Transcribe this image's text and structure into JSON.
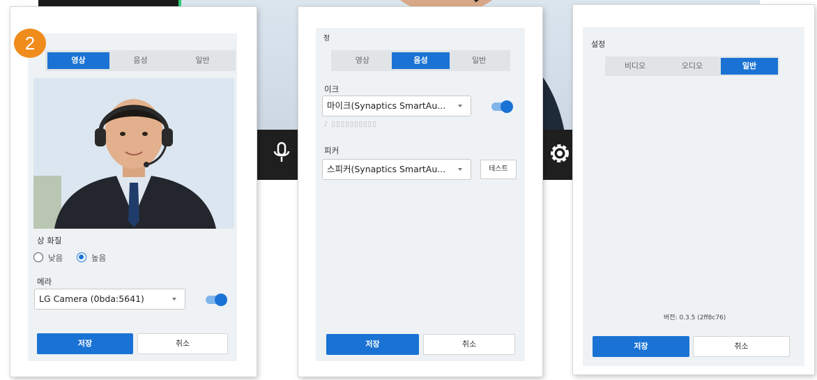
{
  "step_badge": "2",
  "panel1": {
    "tabs": [
      "영상",
      "음성",
      "일반"
    ],
    "active_tab": 0,
    "quality_label": "상 화질",
    "quality_options": [
      "낮음",
      "높음"
    ],
    "quality_selected": 1,
    "camera_label": "메라",
    "camera_value": "LG Camera (0bda:5641)",
    "camera_enabled": true,
    "save_label": "저장",
    "cancel_label": "취소"
  },
  "panel2": {
    "header": "정",
    "tabs": [
      "영상",
      "음성",
      "일반"
    ],
    "active_tab": 1,
    "mic_label": "이크",
    "mic_value": "마이크(Synaptics SmartAu...",
    "mic_enabled": true,
    "speaker_label": "피커",
    "speaker_value": "스피커(Synaptics SmartAu...",
    "test_label": "테스트",
    "save_label": "저장",
    "cancel_label": "취소"
  },
  "panel3": {
    "header": "설정",
    "tabs": [
      "비디오",
      "오디오",
      "일반"
    ],
    "active_tab": 2,
    "version": "버전: 0.3.5 (2ff8c76)",
    "save_label": "저장",
    "cancel_label": "취소"
  },
  "icons": [
    "microphone-icon",
    "settings-icon",
    "dropdown-caret-icon"
  ],
  "colors": {
    "accent": "#1a73d4",
    "badge": "#f08c1c",
    "panel_bg": "#eef2f4",
    "toolbar": "#1f1f1f"
  }
}
